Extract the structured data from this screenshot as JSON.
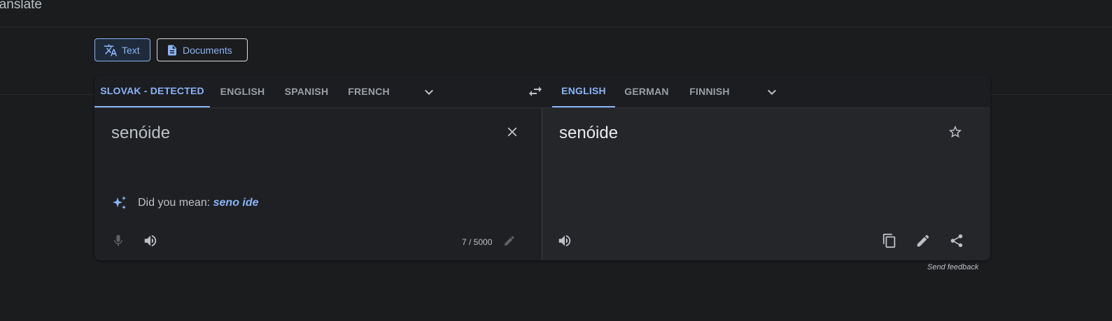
{
  "app": {
    "title": "Google Translate"
  },
  "modes": [
    {
      "label": "Text",
      "icon": "translate-icon",
      "active": true
    },
    {
      "label": "Documents",
      "icon": "document-icon",
      "active": false
    }
  ],
  "source_langs": [
    "SLOVAK - DETECTED",
    "ENGLISH",
    "SPANISH",
    "FRENCH"
  ],
  "target_langs": [
    "ENGLISH",
    "GERMAN",
    "FINNISH"
  ],
  "source": {
    "text": "senóide",
    "did_you_mean_prefix": "Did you mean:",
    "did_you_mean_suggestion": "seno ide",
    "char_count": "7 / 5000"
  },
  "target": {
    "text": "senóide"
  },
  "footer": {
    "feedback": "Send feedback"
  },
  "colors": {
    "accent": "#8ab4f8",
    "background": "#1b1c1e",
    "panel": "#202124"
  }
}
